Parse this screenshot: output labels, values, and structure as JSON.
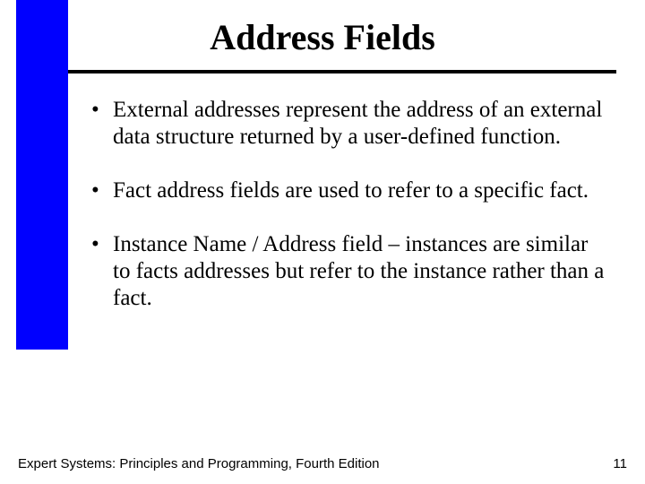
{
  "title": "Address Fields",
  "bullets": [
    "External addresses represent the address of an external data structure returned by a user-defined function.",
    "Fact address fields are used to refer to a specific fact.",
    "Instance Name / Address field – instances are similar to facts addresses but refer to the instance rather than a fact."
  ],
  "footer": {
    "source": "Expert Systems: Principles and Programming, Fourth Edition",
    "page": "11"
  }
}
